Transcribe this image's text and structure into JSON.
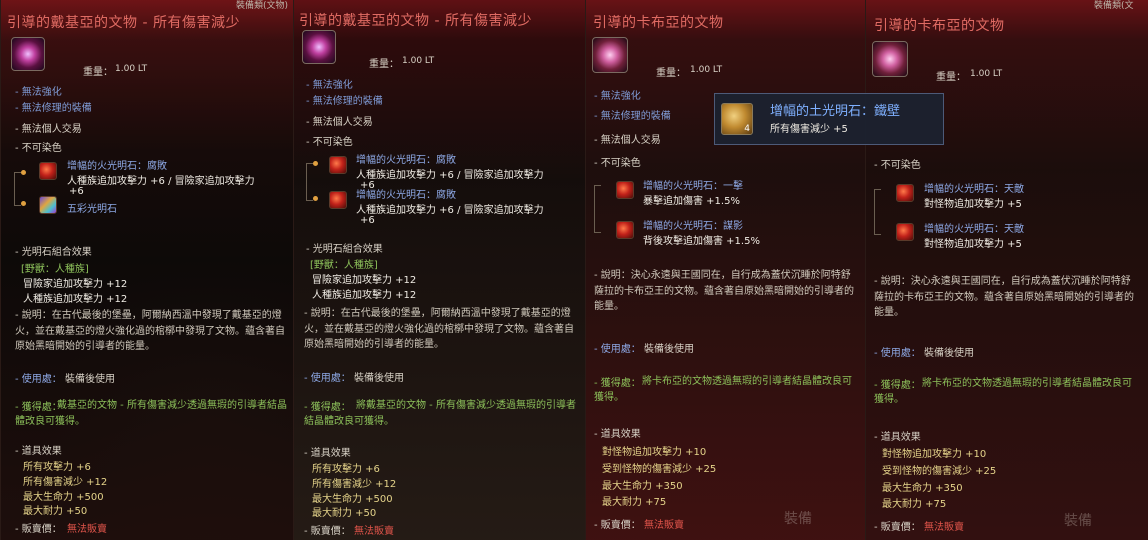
{
  "panels": [
    {
      "header_tag": "裝備類(文物)",
      "title": "引導的戴基亞的文物 - 所有傷害減少",
      "weight_label": "重量：",
      "weight_value": "1.00 LT",
      "props": [
        "- 無法強化",
        "- 無法修理的裝備",
        "- 無法個人交易",
        "- 不可染色"
      ],
      "crystals": [
        {
          "name": "增幅的火光明石：腐敗",
          "effect": "人種族追加攻擊力 +6 / 冒險家追加攻擊力",
          "effect2": "+6"
        },
        {
          "name": "五彩光明石"
        }
      ],
      "combo_title": "- 光明石組合效果",
      "combo_tag": "[野獸：人種族]",
      "combo_lines": [
        "冒險家追加攻擊力 +12",
        "人種族追加攻擊力 +12"
      ],
      "desc": "- 說明：在古代最後的堡壘，阿爾納西溫中發現了戴基亞的燈火，並在戴基亞的燈火強化過的棺槨中發現了文物。蘊含著自原始黑暗開始的引導者的能量。",
      "usage_label": "- 使用處：",
      "usage_value": "裝備後使用",
      "obtain_label": "- 獲得處：",
      "obtain_value": "戴基亞的文物 - 所有傷害減少透過無瑕的引導者結晶體改良可獲得。",
      "effects_title": "- 道具效果",
      "effects": [
        "所有攻擊力 +6",
        "所有傷害減少 +12",
        "最大生命力 +500",
        "最大耐力 +50"
      ],
      "price_label": "- 販賣價：",
      "price_value": "無法販賣"
    },
    {
      "title": "引導的戴基亞的文物 - 所有傷害減少",
      "weight_label": "重量：",
      "weight_value": "1.00 LT",
      "props": [
        "- 無法強化",
        "- 無法修理的裝備",
        "- 無法個人交易",
        "- 不可染色"
      ],
      "crystals": [
        {
          "name": "增幅的火光明石：腐敗",
          "effect": "人種族追加攻擊力 +6 / 冒險家追加攻擊力",
          "effect2": "+6"
        },
        {
          "name": "增幅的火光明石：腐敗",
          "effect": "人種族追加攻擊力 +6 / 冒險家追加攻擊力",
          "effect2": "+6"
        }
      ],
      "combo_title": "- 光明石組合效果",
      "combo_tag": "[野獸：人種族]",
      "combo_lines": [
        "冒險家追加攻擊力 +12",
        "人種族追加攻擊力 +12"
      ],
      "desc": "- 說明：在古代最後的堡壘，阿爾納西溫中發現了戴基亞的燈火，並在戴基亞的燈火強化過的棺槨中發現了文物。蘊含著自原始黑暗開始的引導者的能量。",
      "usage_label": "- 使用處：",
      "usage_value": "裝備後使用",
      "obtain_label": "- 獲得處：",
      "obtain_value": "將戴基亞的文物 - 所有傷害減少透過無瑕的引導者結晶體改良可獲得。",
      "effects_title": "- 道具效果",
      "effects": [
        "所有攻擊力 +6",
        "所有傷害減少 +12",
        "最大生命力 +500",
        "最大耐力 +50"
      ],
      "price_label": "- 販賣價：",
      "price_value": "無法販賣"
    },
    {
      "title": "引導的卡布亞的文物",
      "weight_label": "重量：",
      "weight_value": "1.00 LT",
      "props": [
        "- 無法強化",
        "- 無法修理的裝備",
        "- 無法個人交易",
        "- 不可染色"
      ],
      "crystals": [
        {
          "name": "增幅的火光明石：一擊",
          "effect": "暴擊追加傷害 +1.5%"
        },
        {
          "name": "增幅的火光明石：謀影",
          "effect": "背後攻擊追加傷害 +1.5%"
        }
      ],
      "desc": "- 說明：決心永遠與王國同在，自行成為蓋伏沉睡於阿特舒薩拉的卡布亞王的文物。蘊含著自原始黑暗開始的引導者的能量。",
      "usage_label": "- 使用處：",
      "usage_value": "裝備後使用",
      "obtain_label": "- 獲得處：",
      "obtain_value": "將卡布亞的文物透過無瑕的引導者結晶體改良可獲得。",
      "effects_title": "- 道具效果",
      "effects": [
        "對怪物追加攻擊力 +10",
        "受到怪物的傷害減少 +25",
        "最大生命力 +350",
        "最大耐力 +75"
      ],
      "price_label": "- 販賣價：",
      "price_value": "無法販賣",
      "ghost_button": "裝備"
    },
    {
      "header_tag": "裝備類(文",
      "title": "引導的卡布亞的文物",
      "weight_label": "重量：",
      "weight_value": "1.00 LT",
      "props": [
        "- 不可染色"
      ],
      "crystals": [
        {
          "name": "增幅的火光明石：天敵",
          "effect": "對怪物追加攻擊力 +5"
        },
        {
          "name": "增幅的火光明石：天敵",
          "effect": "對怪物追加攻擊力 +5"
        }
      ],
      "desc": "- 說明：決心永遠與王國同在，自行成為蓋伏沉睡於阿特舒薩拉的卡布亞王的文物。蘊含著自原始黑暗開始的引導者的能量。",
      "usage_label": "- 使用處：",
      "usage_value": "裝備後使用",
      "obtain_label": "- 獲得處：",
      "obtain_value": "將卡布亞的文物透過無瑕的引導者結晶體改良可獲得。",
      "effects_title": "- 道具效果",
      "effects": [
        "對怪物追加攻擊力 +10",
        "受到怪物的傷害減少 +25",
        "最大生命力 +350",
        "最大耐力 +75"
      ],
      "price_label": "- 販賣價：",
      "price_value": "無法販賣",
      "ghost_button": "裝備"
    }
  ],
  "popup": {
    "title": "增幅的土光明石：鐵壁",
    "effect": "所有傷害減少 +5",
    "badge": "4"
  }
}
